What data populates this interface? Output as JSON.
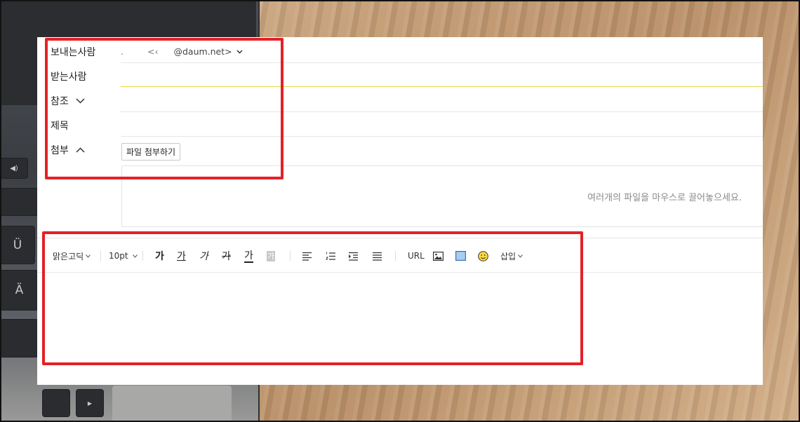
{
  "compose": {
    "sender_label": "보내는사람",
    "sender_name": ".",
    "sender_bracket": "<‹",
    "sender_domain": "@daum.net>",
    "recipient_label": "받는사람",
    "cc_label": "참조",
    "subject_label": "제목",
    "attach_label": "첨부",
    "attach_button": "파일 첨부하기",
    "dropzone_hint": "여러개의 파일을 마우스로 끌어놓으세요."
  },
  "toolbar": {
    "font_family": "맑은고딕",
    "font_size": "10pt",
    "bold": "가",
    "underline": "가",
    "italic": "가",
    "strike": "가",
    "font_color": "가",
    "bg_color": "가",
    "url": "URL",
    "insert": "삽입"
  },
  "icons": [
    "chevron-down-icon",
    "chevron-up-icon",
    "align-left-icon",
    "numbered-list-icon",
    "indent-icon",
    "line-spacing-icon",
    "image-icon",
    "box-icon",
    "emoji-icon"
  ],
  "colors": {
    "highlight": "#e32126",
    "focus_line": "#e8d84a",
    "box_fill": "#a9cdf0"
  },
  "background_keys": [
    "Ü",
    "Ä"
  ]
}
